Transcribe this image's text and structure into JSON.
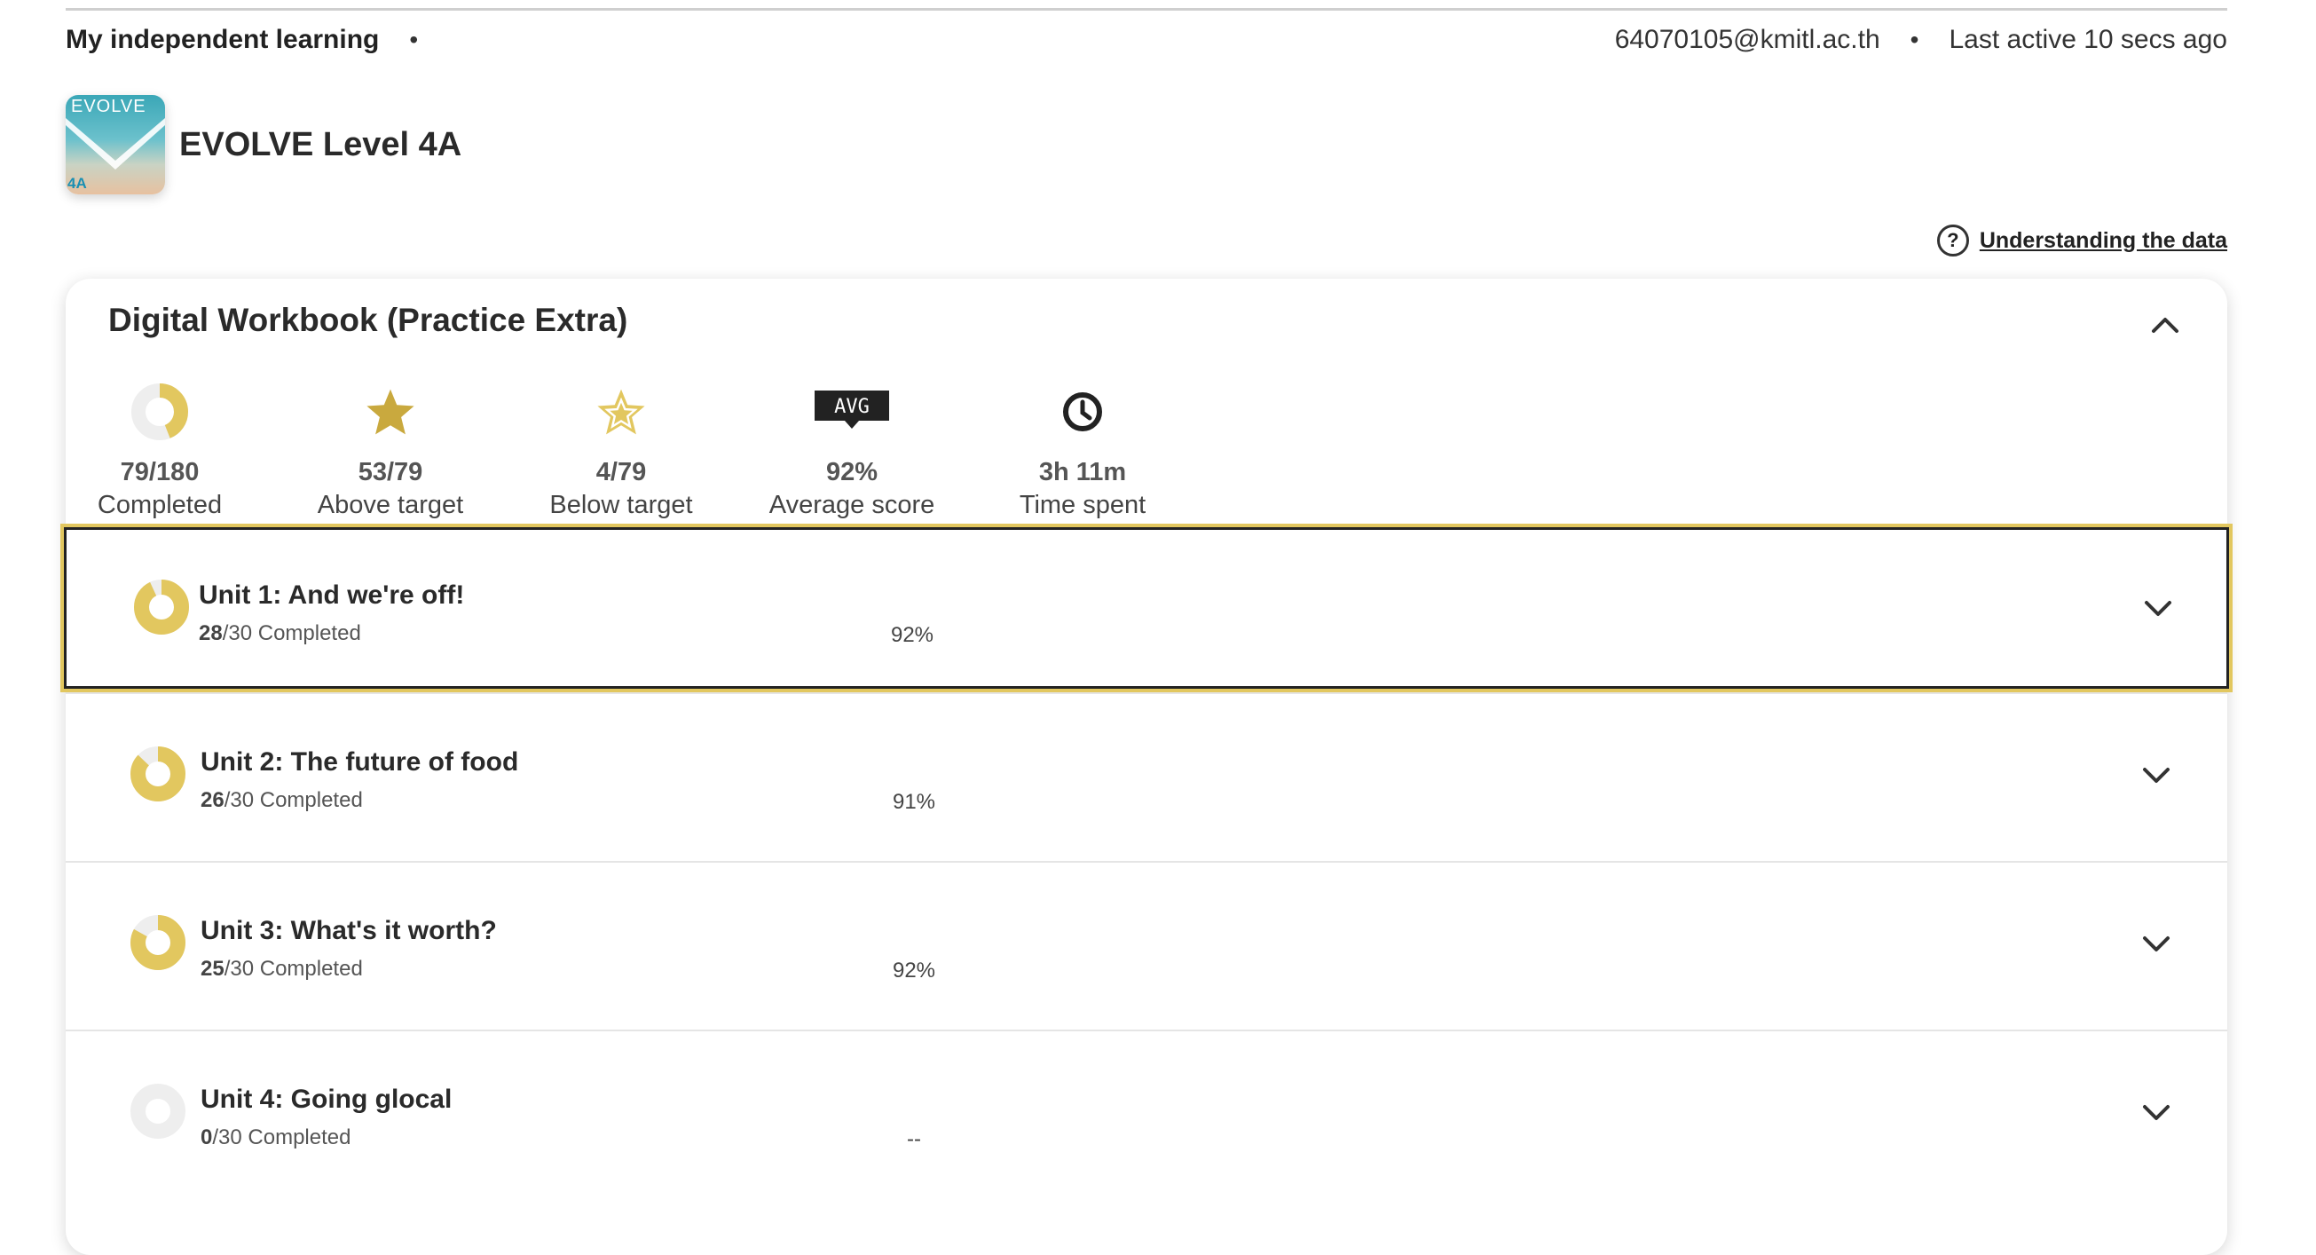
{
  "header": {
    "title": "My independent learning",
    "separator": "•",
    "email": "64070105@kmitl.ac.th",
    "last_active": "Last active 10 secs ago"
  },
  "course": {
    "logo_brand": "EVOLVE",
    "logo_level": "4A",
    "title": "EVOLVE Level 4A"
  },
  "help": {
    "icon": "question-circle-icon",
    "link_label": "Understanding the data"
  },
  "section": {
    "title": "Digital Workbook (Practice Extra)",
    "collapse_icon": "chevron-up-icon"
  },
  "stats": {
    "completed": {
      "value": "79/180",
      "label": "Completed",
      "fraction": 0.44
    },
    "above": {
      "value": "53/79",
      "label": "Above target"
    },
    "below": {
      "value": "4/79",
      "label": "Below target"
    },
    "average": {
      "value": "92%",
      "label": "Average score",
      "badge": "AVG"
    },
    "time": {
      "value": "3h 11m",
      "label": "Time spent"
    }
  },
  "units": [
    {
      "name": "Unit 1: And we're off!",
      "done": "28",
      "total": "/30 Completed",
      "score": "92%",
      "fraction": 0.93
    },
    {
      "name": "Unit 2: The future of food",
      "done": "26",
      "total": "/30 Completed",
      "score": "91%",
      "fraction": 0.87
    },
    {
      "name": "Unit 3: What's it worth?",
      "done": "25",
      "total": "/30 Completed",
      "score": "92%",
      "fraction": 0.83
    },
    {
      "name": "Unit 4: Going glocal",
      "done": "0",
      "total": "/30 Completed",
      "score": "--",
      "fraction": 0
    }
  ],
  "colors": {
    "accent": "#e2c75f",
    "track": "#eeeeee",
    "dark": "#333333"
  }
}
